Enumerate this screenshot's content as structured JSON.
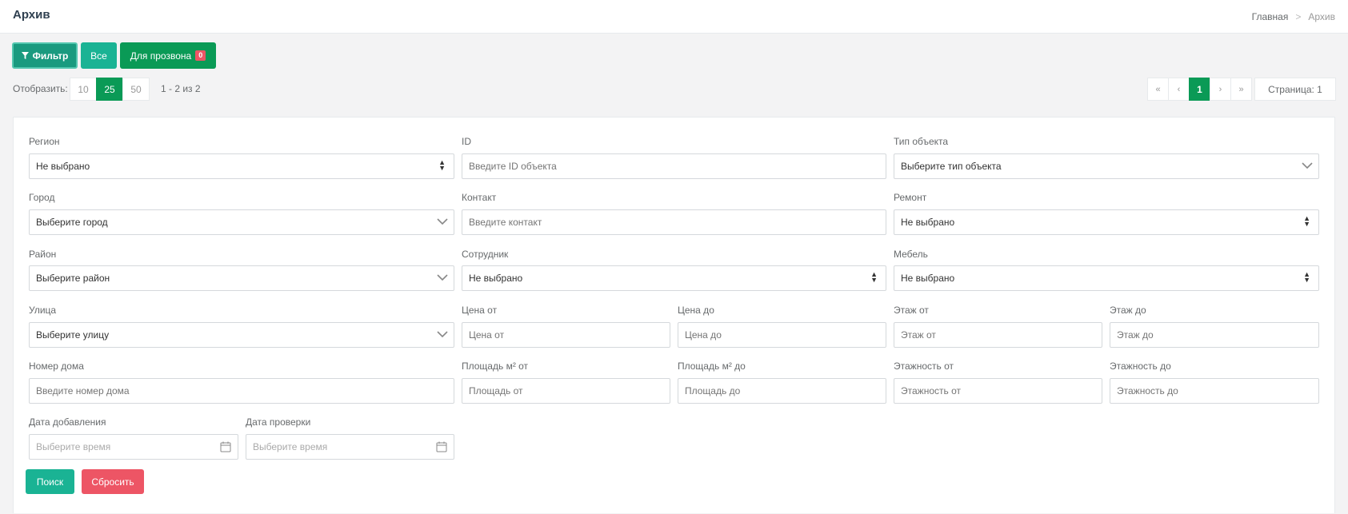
{
  "header": {
    "title": "Архив",
    "breadcrumb": {
      "home": "Главная",
      "current": "Архив"
    }
  },
  "toolbar": {
    "filter_label": "Фильтр",
    "all_label": "Все",
    "call_label": "Для прозвона",
    "call_count": "0"
  },
  "pager": {
    "show_label": "Отобразить:",
    "sizes": [
      "10",
      "25",
      "50"
    ],
    "active_size": "25",
    "range": "1 - 2 из 2",
    "first": "«",
    "prev": "‹",
    "current": "1",
    "next": "›",
    "last": "»",
    "page_label": "Страница: 1"
  },
  "filters": {
    "region": {
      "label": "Регион",
      "value": "Не выбрано"
    },
    "id": {
      "label": "ID",
      "placeholder": "Введите ID объекта"
    },
    "object_type": {
      "label": "Тип объекта",
      "value": "Выберите тип объекта"
    },
    "city": {
      "label": "Город",
      "value": "Выберите город"
    },
    "contact": {
      "label": "Контакт",
      "placeholder": "Введите контакт"
    },
    "repair": {
      "label": "Ремонт",
      "value": "Не выбрано"
    },
    "district": {
      "label": "Район",
      "value": "Выберите район"
    },
    "employee": {
      "label": "Сотрудник",
      "value": "Не выбрано"
    },
    "furniture": {
      "label": "Мебель",
      "value": "Не выбрано"
    },
    "street": {
      "label": "Улица",
      "value": "Выберите улицу"
    },
    "price_from": {
      "label": "Цена от",
      "placeholder": "Цена от"
    },
    "price_to": {
      "label": "Цена до",
      "placeholder": "Цена до"
    },
    "floor_from": {
      "label": "Этаж от",
      "placeholder": "Этаж от"
    },
    "floor_to": {
      "label": "Этаж до",
      "placeholder": "Этаж до"
    },
    "house_number": {
      "label": "Номер дома",
      "placeholder": "Введите номер дома"
    },
    "area_from": {
      "label": "Площадь м² от",
      "placeholder": "Площадь от"
    },
    "area_to": {
      "label": "Площадь м² до",
      "placeholder": "Площадь до"
    },
    "floors_from": {
      "label": "Этажность от",
      "placeholder": "Этажность от"
    },
    "floors_to": {
      "label": "Этажность до",
      "placeholder": "Этажность до"
    },
    "date_added": {
      "label": "Дата добавления",
      "placeholder": "Выберите время"
    },
    "date_checked": {
      "label": "Дата проверки",
      "placeholder": "Выберите время"
    }
  },
  "actions": {
    "search_label": "Поиск",
    "reset_label": "Сбросить"
  },
  "colors": {
    "primary": "#1ab394",
    "dark_green": "#0a9a56",
    "danger": "#ed5565"
  }
}
